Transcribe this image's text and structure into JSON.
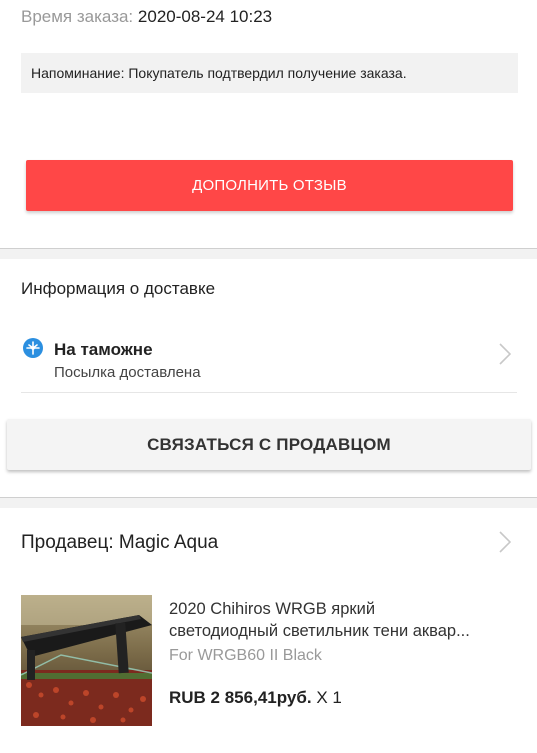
{
  "order": {
    "time_label": "Время заказа:",
    "time_value": "2020-08-24 10:23",
    "reminder": "Напоминание: Покупатель подтвердил получение заказа."
  },
  "actions": {
    "add_review": "ДОПОЛНИТЬ ОТЗЫВ",
    "contact_seller": "СВЯЗАТЬСЯ С ПРОДАВЦОМ"
  },
  "delivery": {
    "title": "Информация о доставке",
    "status": "На таможне",
    "status_detail": "Посылка доставлена"
  },
  "seller": {
    "label": "Продавец: Magic Aqua"
  },
  "product": {
    "title_line1": "2020 Chihiros WRGB яркий",
    "title_line2": "светодиодный светильник тени аквар...",
    "variant": "For WRGB60 II Black",
    "price": "RUB 2 856,41руб.",
    "quantity": "X 1"
  },
  "colors": {
    "accent": "#ff4747",
    "status_icon": "#2b8fe0"
  }
}
